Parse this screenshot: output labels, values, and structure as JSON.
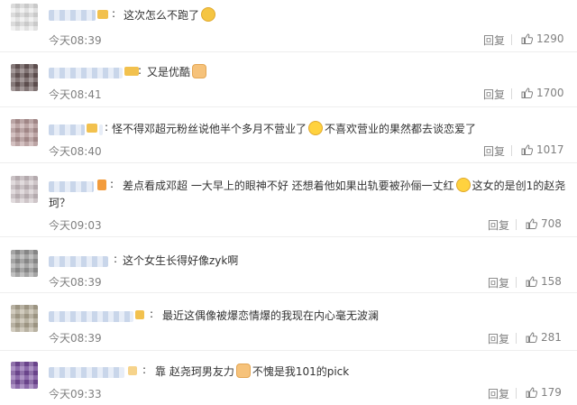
{
  "comments": [
    {
      "text_parts": [
        "这次怎么不跑了"
      ],
      "emojis": [
        "cat-face-emoji"
      ],
      "time": "今天08:39",
      "reply_label": "回复",
      "likes": "1290",
      "avatar_color": "#e8e8e8"
    },
    {
      "text_parts": [
        "又是优酷"
      ],
      "emojis": [
        "pray-hands-emoji"
      ],
      "time": "今天08:41",
      "reply_label": "回复",
      "likes": "1700",
      "avatar_color": "#6b5a5a"
    },
    {
      "text_parts": [
        "怪不得邓超元粉丝说他半个多月不营业了",
        "不喜欢营业的果然都去谈恋爱了"
      ],
      "emojis": [
        "crying-laughing-emoji"
      ],
      "time": "今天08:40",
      "reply_label": "回复",
      "likes": "1017",
      "avatar_color": "#b89a9a"
    },
    {
      "text_parts": [
        "差点看成邓超 一大早上的眼神不好 还想着他如果出轨要被孙俪一丈红",
        "这女的是创1的赵尧",
        "珂？"
      ],
      "emojis": [
        "crying-laughing-emoji"
      ],
      "time": "今天09:03",
      "reply_label": "回复",
      "likes": "708",
      "avatar_color": "#cfc4c8"
    },
    {
      "text_parts": [
        "这个女生长得好像zyk啊"
      ],
      "emojis": [],
      "time": "今天08:39",
      "reply_label": "回复",
      "likes": "158",
      "avatar_color": "#9a9a9a"
    },
    {
      "text_parts": [
        "最近这偶像被爆恋情爆的我现在内心毫无波澜"
      ],
      "emojis": [],
      "time": "今天08:39",
      "reply_label": "回复",
      "likes": "281",
      "avatar_color": "#b4ab96"
    },
    {
      "text_parts": [
        "靠 赵尧珂男友力",
        "不愧是我101的pick"
      ],
      "emojis": [
        "thumbs-up-emoji"
      ],
      "time": "今天09:33",
      "reply_label": "回复",
      "likes": "179",
      "avatar_color": "#7a4fa0"
    }
  ],
  "separator": ":"
}
